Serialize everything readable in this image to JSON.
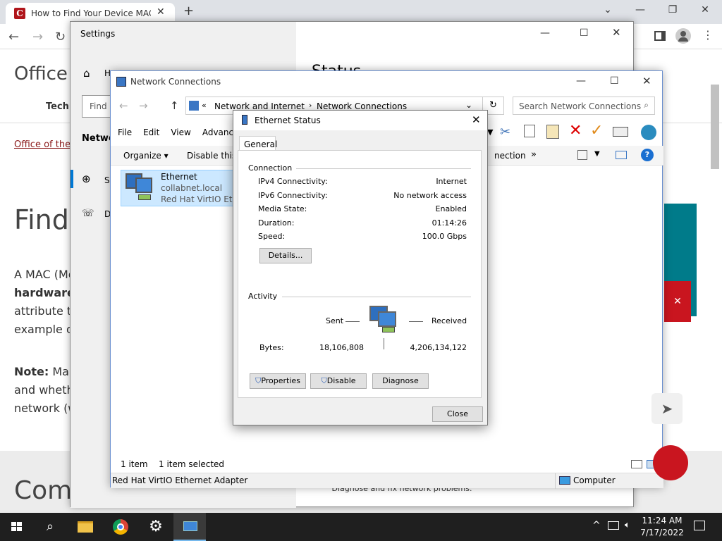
{
  "browser": {
    "tab_title": "How to Find Your Device MAC Address",
    "tab_close": "✕",
    "new_tab": "+",
    "controls": {
      "down": "⌄",
      "min": "—",
      "restore": "❐",
      "close": "✕"
    },
    "page": {
      "logo_fragment": "Office o",
      "nav_fragment": "Tech",
      "breadcrumb_fragment": "Office of the",
      "heading_fragment": "Find",
      "para1_line1": "A MAC (Me",
      "para1_line2": "hardware",
      "para1_line3": "attribute th",
      "para1_line4": "example o",
      "note_label": "Note:",
      "note_line1": " Mar",
      "note_line2": "and wheth",
      "note_line3": "network (w",
      "bottom_fragment": "Com",
      "bottom_right_text": "Diagnose and fix network problems."
    }
  },
  "settings": {
    "title": "Settings",
    "home_fragment": "H",
    "find_placeholder": "Find",
    "network_fragment": "Netwo",
    "status_fragment": "St",
    "dialup_fragment": "D",
    "right_heading": "Status"
  },
  "netconn": {
    "title": "Network Connections",
    "breadcrumb": [
      "Network and Internet",
      "Network Connections"
    ],
    "search_placeholder": "Search Network Connections",
    "menu": [
      "File",
      "Edit",
      "View",
      "Advanced"
    ],
    "organize": "Organize",
    "disable": "Disable this",
    "connection_fragment": "nection",
    "more": "»",
    "item": {
      "name": "Ethernet",
      "domain": "collabnet.local",
      "adapter": "Red Hat VirtIO Ethern"
    },
    "status_count": "1 item",
    "status_selected": "1 item selected",
    "footer_left": "Red Hat VirtIO Ethernet Adapter",
    "footer_right": "Computer"
  },
  "dialog": {
    "title": "Ethernet Status",
    "tab": "General",
    "connection_header": "Connection",
    "rows": [
      {
        "label": "IPv4 Connectivity:",
        "value": "Internet"
      },
      {
        "label": "IPv6 Connectivity:",
        "value": "No network access"
      },
      {
        "label": "Media State:",
        "value": "Enabled"
      },
      {
        "label": "Duration:",
        "value": "01:14:26"
      },
      {
        "label": "Speed:",
        "value": "100.0 Gbps"
      }
    ],
    "details_button": "Details...",
    "activity_header": "Activity",
    "sent_label": "Sent",
    "received_label": "Received",
    "bytes_label": "Bytes:",
    "bytes_sent": "18,106,808",
    "bytes_received": "4,206,134,122",
    "properties_button": "Properties",
    "disable_button": "Disable",
    "diagnose_button": "Diagnose",
    "close_button": "Close"
  },
  "taskbar": {
    "time": "11:24 AM",
    "date": "7/17/2022"
  }
}
